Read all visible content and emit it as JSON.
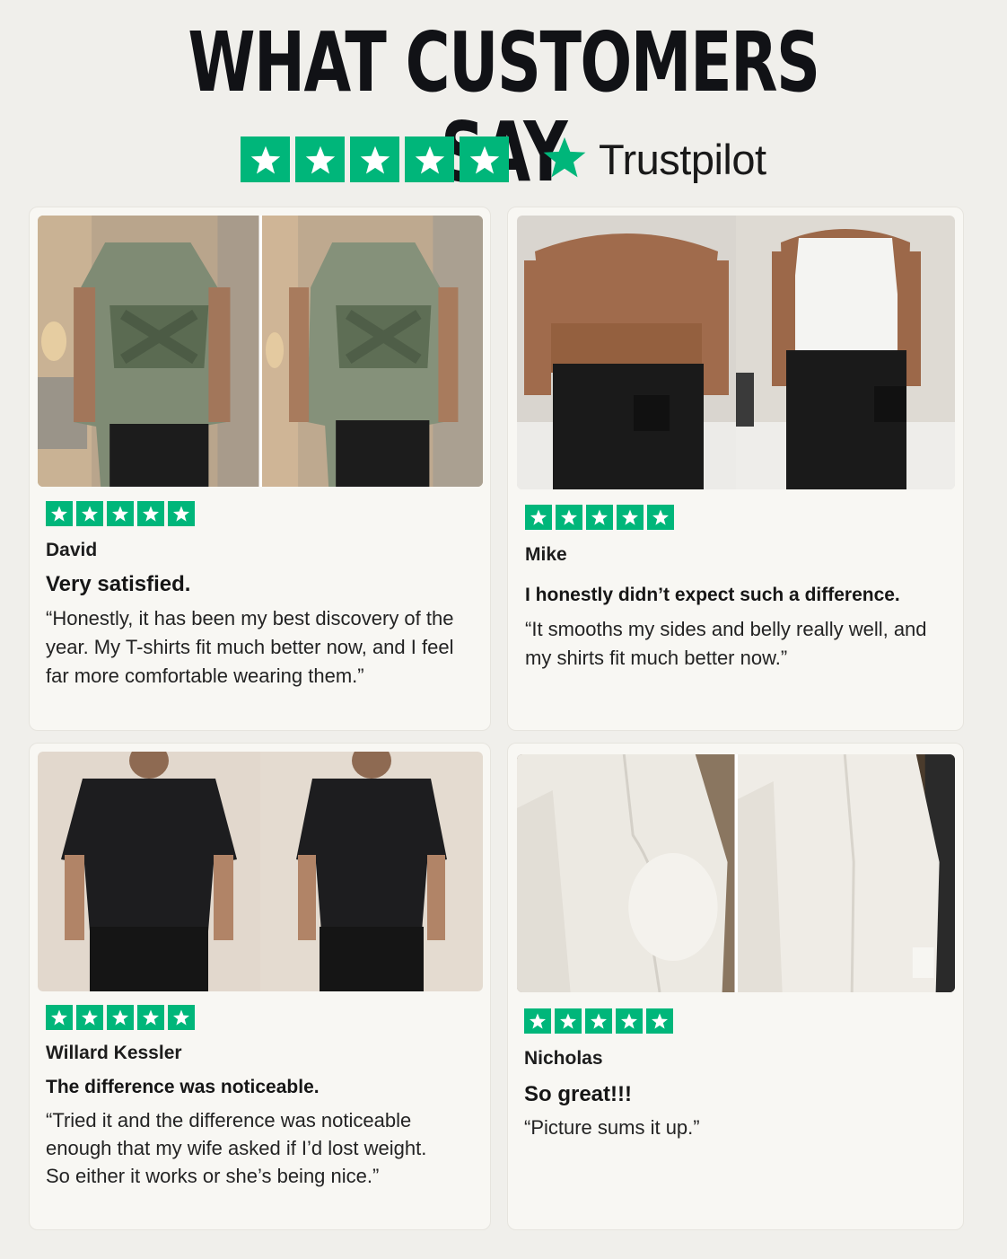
{
  "header": {
    "headline": "WHAT CUSTOMERS SAY",
    "rating_stars": 5,
    "brand": "Trustpilot",
    "star_color": "#00b67a"
  },
  "reviews": [
    {
      "reviewer": "David",
      "rating": 5,
      "title": "Very satisfied.",
      "body": "“Honestly, it has been my best discovery of the year. My T-shirts fit much better now, and I feel far more comfortable wearing them.”",
      "photo_alt": "Before and after: man in green Union Jack T-shirt"
    },
    {
      "reviewer": "Mike",
      "rating": 5,
      "title": "I honestly didn’t expect such a difference.",
      "body": "“It smooths my sides and belly really well, and my shirts fit much better now.”",
      "photo_alt": "Before and after: man's back shirtless and wearing white compression vest"
    },
    {
      "reviewer": "Willard Kessler",
      "rating": 5,
      "title": "The difference was noticeable.",
      "body": "“Tried it and the difference was noticeable enough that my wife asked if I’d lost weight. So either it works or she’s being nice.”",
      "photo_alt": "Before and after: man's back in black T-shirt"
    },
    {
      "reviewer": "Nicholas",
      "rating": 5,
      "title": "So great!!!",
      "body": "“Picture sums it up.”",
      "photo_alt": "Before and after: man in white dress shirt, side view"
    }
  ]
}
